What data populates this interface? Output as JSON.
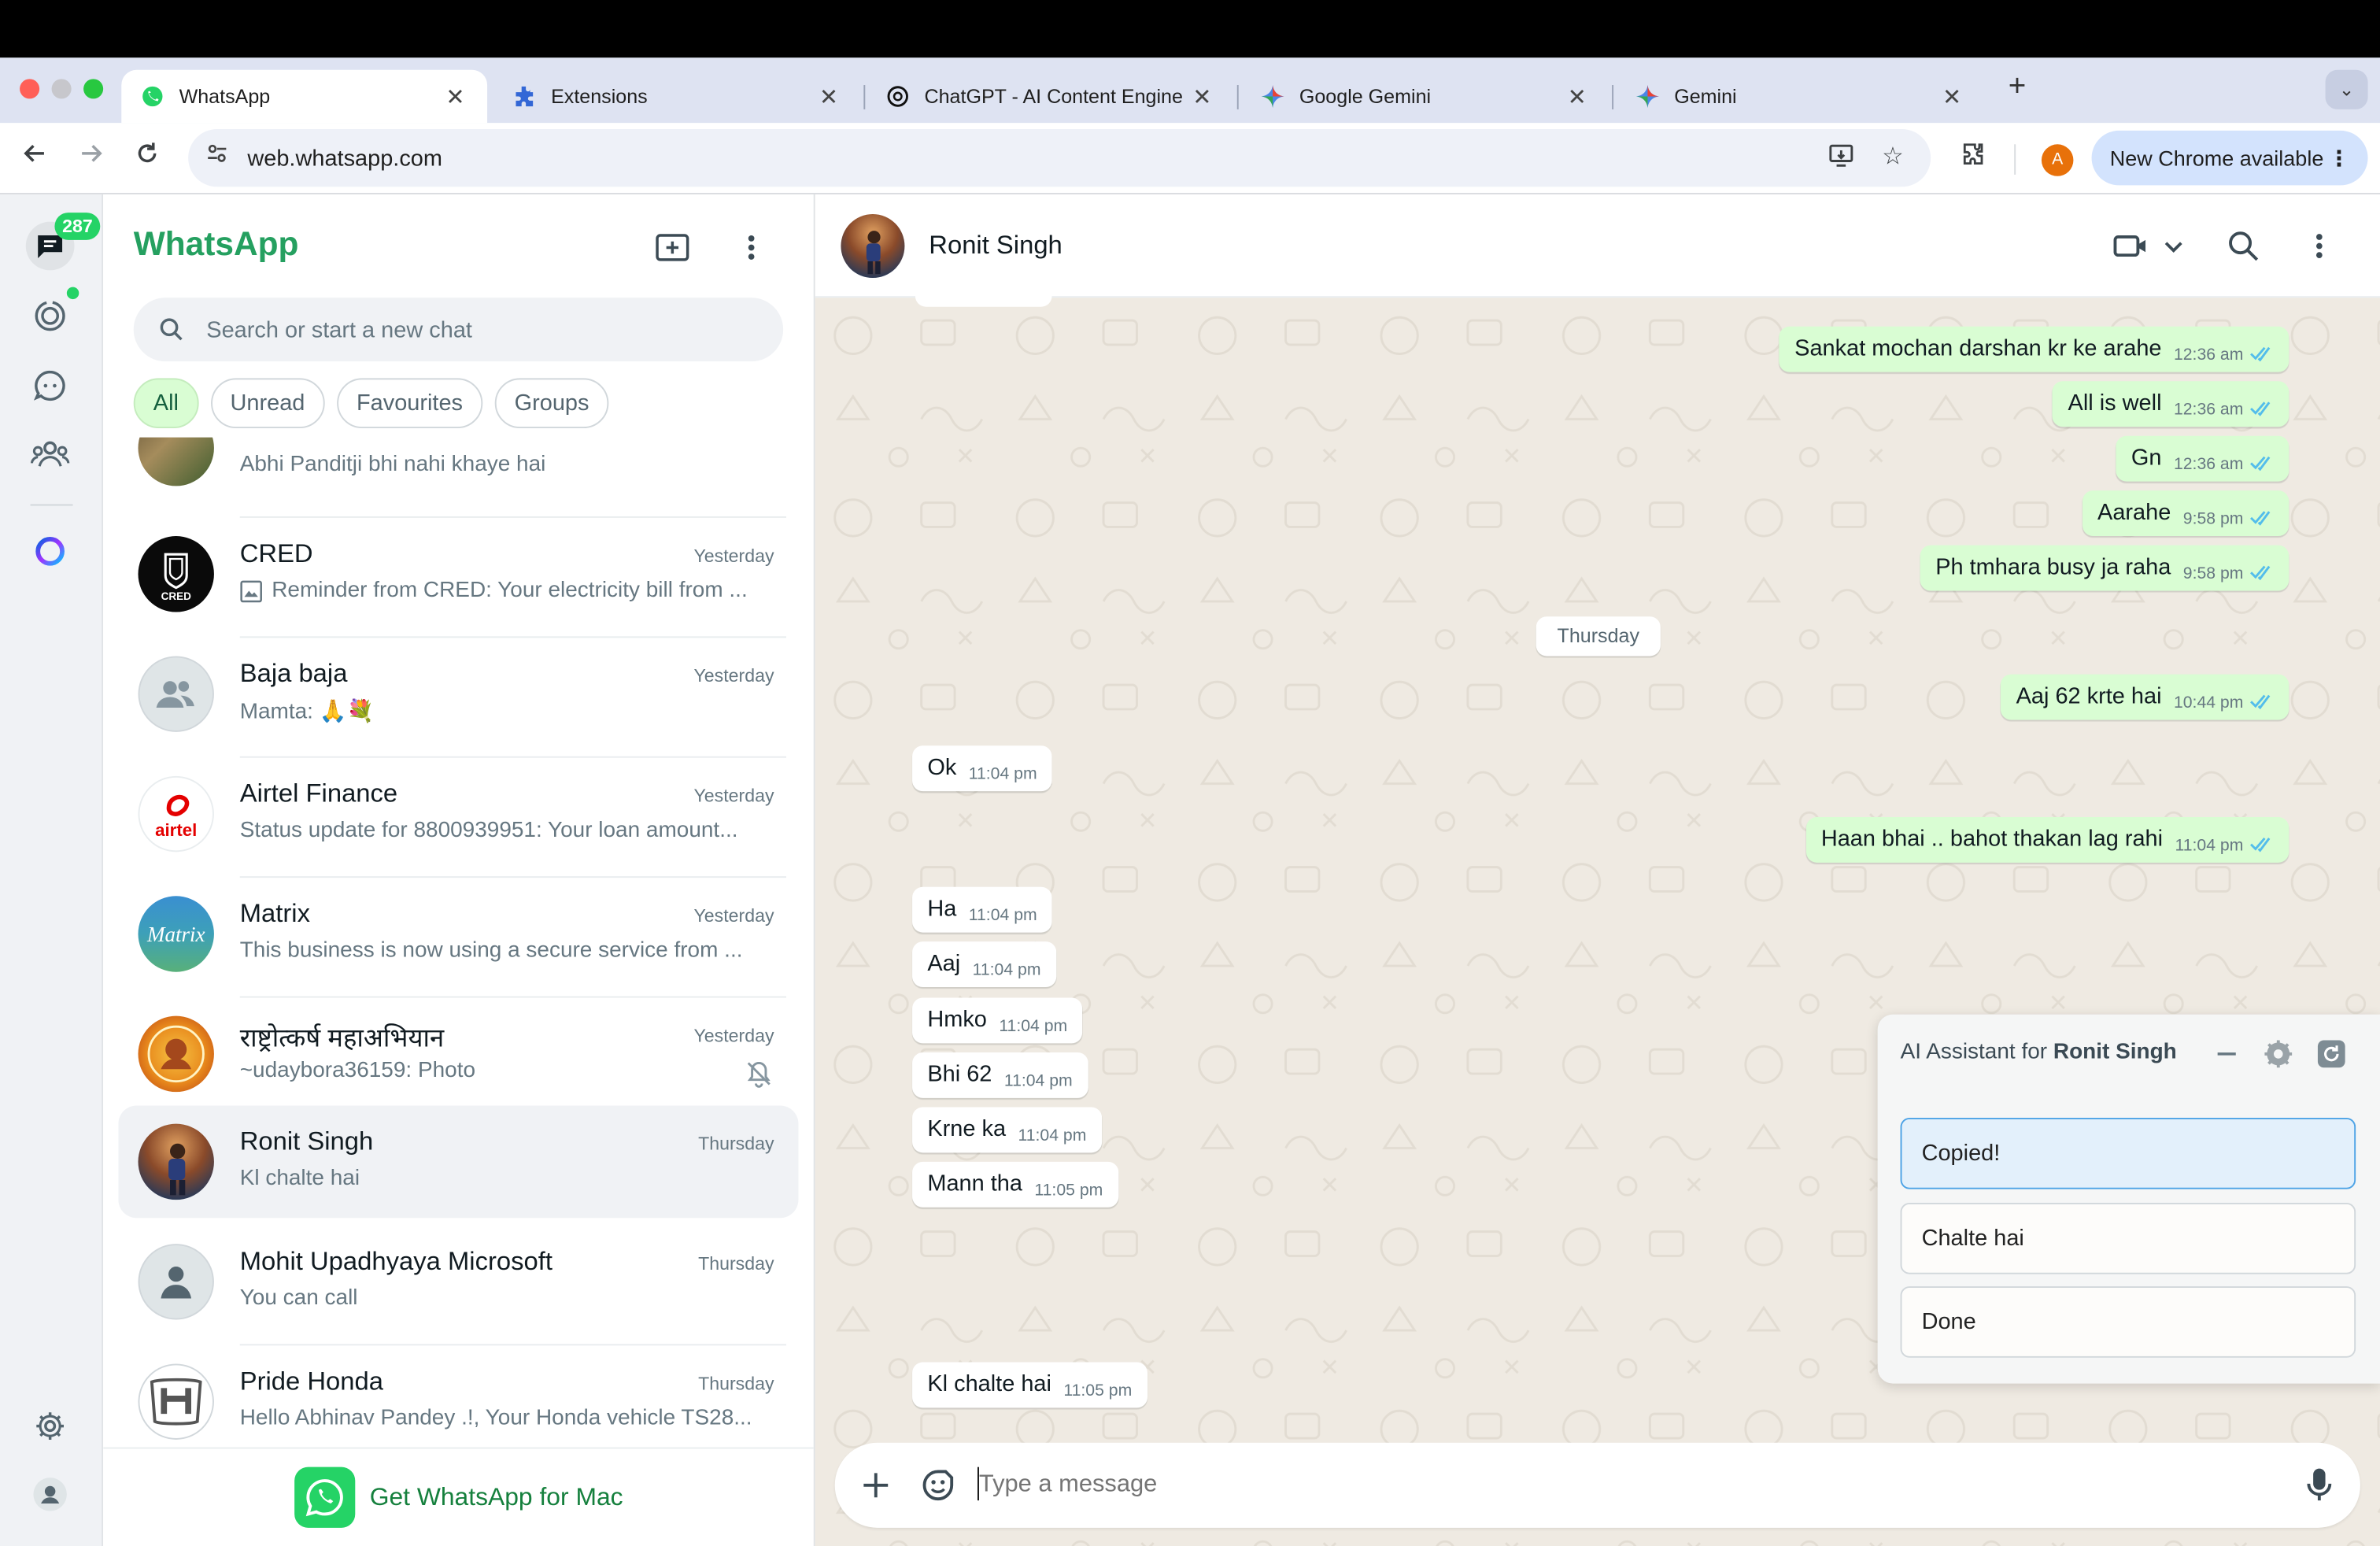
{
  "browser": {
    "tabs": [
      {
        "title": "WhatsApp",
        "icon": "whatsapp-favicon",
        "active": true
      },
      {
        "title": "Extensions",
        "icon": "puzzle-favicon"
      },
      {
        "title": "ChatGPT - AI Content Engine",
        "icon": "openai-favicon"
      },
      {
        "title": "Google Gemini",
        "icon": "gemini-favicon"
      },
      {
        "title": "Gemini",
        "icon": "gemini-favicon"
      }
    ],
    "url": "web.whatsapp.com",
    "profile_initial": "A",
    "update_label": "New Chrome available"
  },
  "rail": {
    "chats_badge": "287"
  },
  "sidebar": {
    "title": "WhatsApp",
    "search_placeholder": "Search or start a new chat",
    "filters": [
      "All",
      "Unread",
      "Favourites",
      "Groups"
    ],
    "active_filter": "All",
    "chats": [
      {
        "name": "",
        "time": "",
        "preview": "Abhi Panditji bhi nahi khaye hai",
        "avatar": "photo-tree"
      },
      {
        "name": "CRED",
        "time": "Yesterday",
        "preview": "Reminder from CRED: Your electricity bill from ...",
        "avatar": "cred",
        "has_image_icon": true
      },
      {
        "name": "Baja baja",
        "time": "Yesterday",
        "preview": "Mamta: 🙏💐",
        "avatar": "group"
      },
      {
        "name": "Airtel Finance",
        "time": "Yesterday",
        "preview": "Status update for 8800939951: Your loan amount...",
        "avatar": "airtel"
      },
      {
        "name": "Matrix",
        "time": "Yesterday",
        "preview": "This business is now using a secure service from ...",
        "avatar": "matrix"
      },
      {
        "name": "राष्ट्रोत्कर्ष महाअभियान",
        "time": "Yesterday",
        "preview": "~udaybora36159:  Photo",
        "avatar": "orange-seal",
        "muted": true
      },
      {
        "name": "Ronit Singh",
        "time": "Thursday",
        "preview": "Kl chalte hai",
        "avatar": "photo-person",
        "selected": true
      },
      {
        "name": "Mohit Upadhyaya Microsoft",
        "time": "Thursday",
        "preview": "You can call",
        "avatar": "person"
      },
      {
        "name": "Pride Honda",
        "time": "Thursday",
        "preview": "Hello Abhinav Pandey .!, Your Honda vehicle TS28...",
        "avatar": "honda"
      }
    ],
    "get_app_label": "Get WhatsApp for Mac"
  },
  "conversation": {
    "contact_name": "Ronit Singh",
    "date_divider": "Thursday",
    "messages": [
      {
        "dir": "out",
        "text": "Sankat mochan darshan kr ke arahe",
        "time": "12:36 am"
      },
      {
        "dir": "out",
        "text": "All is well",
        "time": "12:36 am"
      },
      {
        "dir": "out",
        "text": "Gn",
        "time": "12:36 am"
      },
      {
        "dir": "out",
        "text": "Aarahe",
        "time": "9:58 pm"
      },
      {
        "dir": "out",
        "text": "Ph tmhara busy ja raha",
        "time": "9:58 pm"
      },
      {
        "dir": "out",
        "text": "Aaj 62 krte hai",
        "time": "10:44 pm"
      },
      {
        "dir": "in",
        "text": "Ok",
        "time": "11:04 pm"
      },
      {
        "dir": "out",
        "text": "Haan bhai .. bahot thakan lag rahi",
        "time": "11:04 pm"
      },
      {
        "dir": "in",
        "text": "Ha",
        "time": "11:04 pm"
      },
      {
        "dir": "in",
        "text": "Aaj",
        "time": "11:04 pm"
      },
      {
        "dir": "in",
        "text": "Hmko",
        "time": "11:04 pm"
      },
      {
        "dir": "in",
        "text": "Bhi 62",
        "time": "11:04 pm"
      },
      {
        "dir": "in",
        "text": "Krne ka",
        "time": "11:04 pm"
      },
      {
        "dir": "in",
        "text": "Mann tha",
        "time": "11:05 pm"
      },
      {
        "dir": "in",
        "text": "Kl chalte hai",
        "time": "11:05 pm"
      }
    ],
    "composer_placeholder": "Type a message"
  },
  "ai_assistant": {
    "title_prefix": "AI Assistant for ",
    "title_name": "Ronit Singh",
    "options": [
      "Copied!",
      "Chalte hai",
      "Done"
    ]
  },
  "colors": {
    "brand": "#25a060",
    "outgoing_bubble": "#d9fdd3",
    "chat_background": "#efeae2",
    "tick_blue": "#53bdeb",
    "badge_green": "#25d366"
  }
}
